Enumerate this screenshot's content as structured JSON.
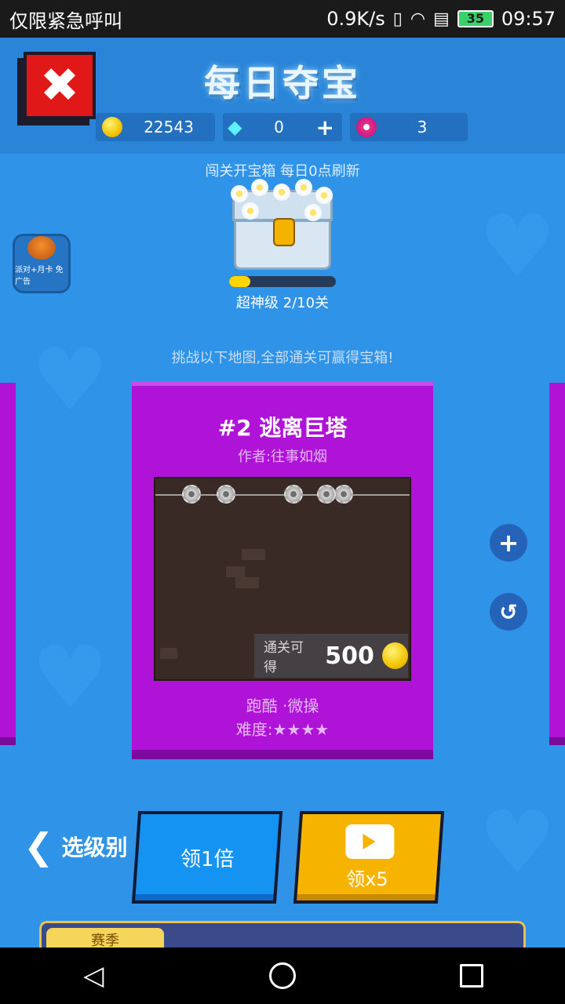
{
  "status_bar": {
    "carrier": "仅限紧急呼叫",
    "speed": "0.9K/s",
    "battery": "35",
    "time": "09:57"
  },
  "header": {
    "title": "每日夺宝",
    "coins": "22543",
    "gems": "0",
    "flowers": "3"
  },
  "chest": {
    "notice": "闯关开宝箱 每日0点刷新",
    "level_label": "超神级 2/10关",
    "progress": 0.2
  },
  "side_badge": "派对+月卡 免广告",
  "challenge_text": "挑战以下地图,全部通关可赢得宝箱!",
  "card": {
    "title": "#2 逃离巨塔",
    "author": "作者:往事如烟",
    "reward_label": "通关可得",
    "reward_value": "500",
    "tags": "跑酷 ·微操",
    "difficulty": "难度:★★★★"
  },
  "buttons": {
    "back": "选级别",
    "claim1": "领1倍",
    "claim5": "领x5"
  },
  "banner": {
    "tag": "赛季"
  },
  "colors": {
    "background": "#2f93e8",
    "card": "#b013d8",
    "blue_button": "#1493f2",
    "yellow_button": "#f6b400",
    "close_button": "#e01818"
  },
  "icons": [
    "close-icon",
    "coin-icon",
    "gem-icon",
    "flower-icon",
    "plus-icon",
    "history-icon",
    "video-icon",
    "back-arrow-icon"
  ]
}
